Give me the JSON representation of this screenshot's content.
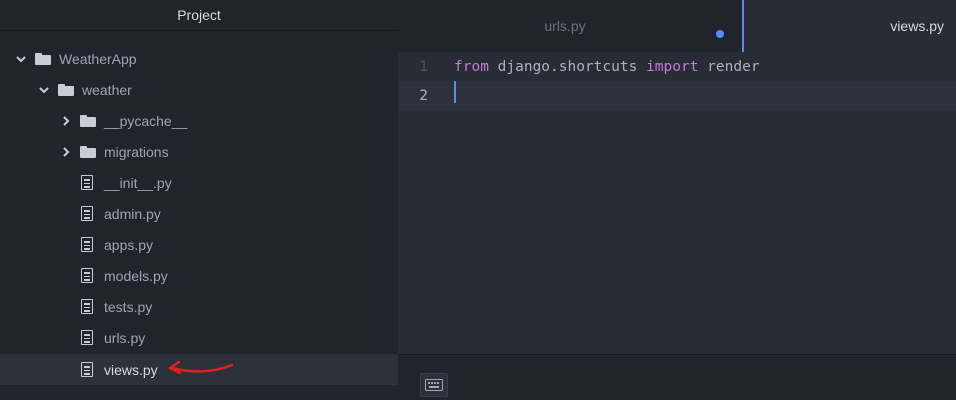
{
  "sidebar": {
    "title": "Project",
    "tree": [
      {
        "label": "WeatherApp",
        "type": "folder",
        "expanded": true,
        "depth": 0
      },
      {
        "label": "weather",
        "type": "folder",
        "expanded": true,
        "depth": 1
      },
      {
        "label": "__pycache__",
        "type": "folder",
        "expanded": false,
        "depth": 2
      },
      {
        "label": "migrations",
        "type": "folder",
        "expanded": false,
        "depth": 2
      },
      {
        "label": "__init__.py",
        "type": "file",
        "depth": 2
      },
      {
        "label": "admin.py",
        "type": "file",
        "depth": 2
      },
      {
        "label": "apps.py",
        "type": "file",
        "depth": 2
      },
      {
        "label": "models.py",
        "type": "file",
        "depth": 2
      },
      {
        "label": "tests.py",
        "type": "file",
        "depth": 2
      },
      {
        "label": "urls.py",
        "type": "file",
        "depth": 2
      },
      {
        "label": "views.py",
        "type": "file",
        "depth": 2,
        "selected": true
      }
    ],
    "annotation": "red-arrow-pointing-left",
    "annotation_color": "#e02020"
  },
  "editor": {
    "tabs": [
      {
        "label": "urls.py",
        "active": false,
        "modified": true
      },
      {
        "label": "views.py",
        "active": true,
        "modified": false
      }
    ],
    "lines": [
      {
        "number": "1",
        "tokens": [
          {
            "text": "from",
            "kind": "keyword"
          },
          {
            "text": " django.shortcuts ",
            "kind": "plain"
          },
          {
            "text": "import",
            "kind": "keyword"
          },
          {
            "text": " render",
            "kind": "plain"
          }
        ]
      },
      {
        "number": "2",
        "tokens": [],
        "current": true
      }
    ],
    "status_icon": "keyboard-icon"
  },
  "colors": {
    "accent": "#528bff",
    "keyword": "#c678dd",
    "panel_bg": "#21252b",
    "editor_bg": "#282c34"
  }
}
